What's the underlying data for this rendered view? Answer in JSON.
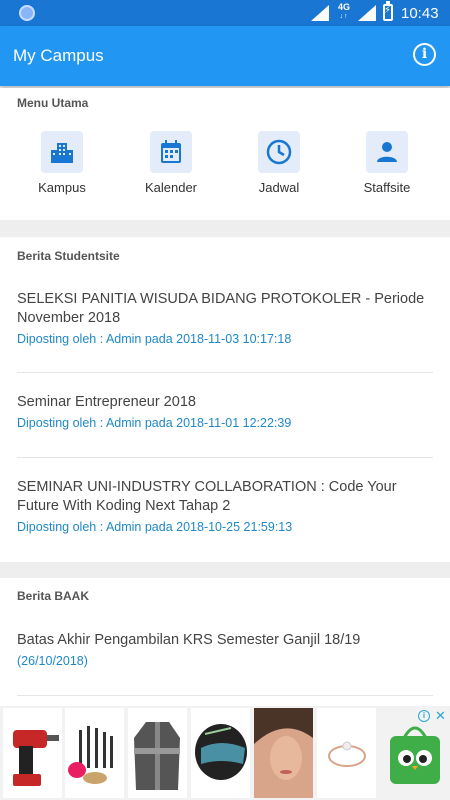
{
  "status_bar": {
    "network": "4G",
    "time": "10:43"
  },
  "app_bar": {
    "title": "My Campus",
    "info_icon": "info-icon"
  },
  "menu": {
    "title": "Menu Utama",
    "items": [
      {
        "label": "Kampus",
        "icon": "building-icon"
      },
      {
        "label": "Kalender",
        "icon": "calendar-icon"
      },
      {
        "label": "Jadwal",
        "icon": "clock-icon"
      },
      {
        "label": "Staffsite",
        "icon": "person-icon"
      }
    ]
  },
  "studentsite": {
    "title": "Berita Studentsite",
    "items": [
      {
        "title": "SELEKSI PANITIA WISUDA BIDANG PROTOKOLER - Periode November 2018",
        "meta": "Diposting oleh : Admin pada 2018-11-03 10:17:18"
      },
      {
        "title": "Seminar Entrepreneur 2018",
        "meta": "Diposting oleh : Admin pada 2018-11-01 12:22:39"
      },
      {
        "title": "SEMINAR UNI-INDUSTRY COLLABORATION : Code Your Future With Koding Next Tahap 2",
        "meta": "Diposting oleh : Admin pada 2018-10-25 21:59:13"
      }
    ]
  },
  "baak": {
    "title": "Berita BAAK",
    "items": [
      {
        "title": "Batas Akhir Pengambilan KRS Semester Ganjil 18/19",
        "meta": "(26/10/2018)"
      }
    ]
  },
  "ad": {
    "products": [
      "drill-image",
      "makeup-brushes-image",
      "jacket-image",
      "helmet-image",
      "model-face-image",
      "ring-image",
      "tokopedia-logo"
    ]
  },
  "colors": {
    "status_bar": "#1976d2",
    "app_bar": "#2196f3",
    "accent": "#1e88c8",
    "icon_blue": "#1976d2"
  }
}
